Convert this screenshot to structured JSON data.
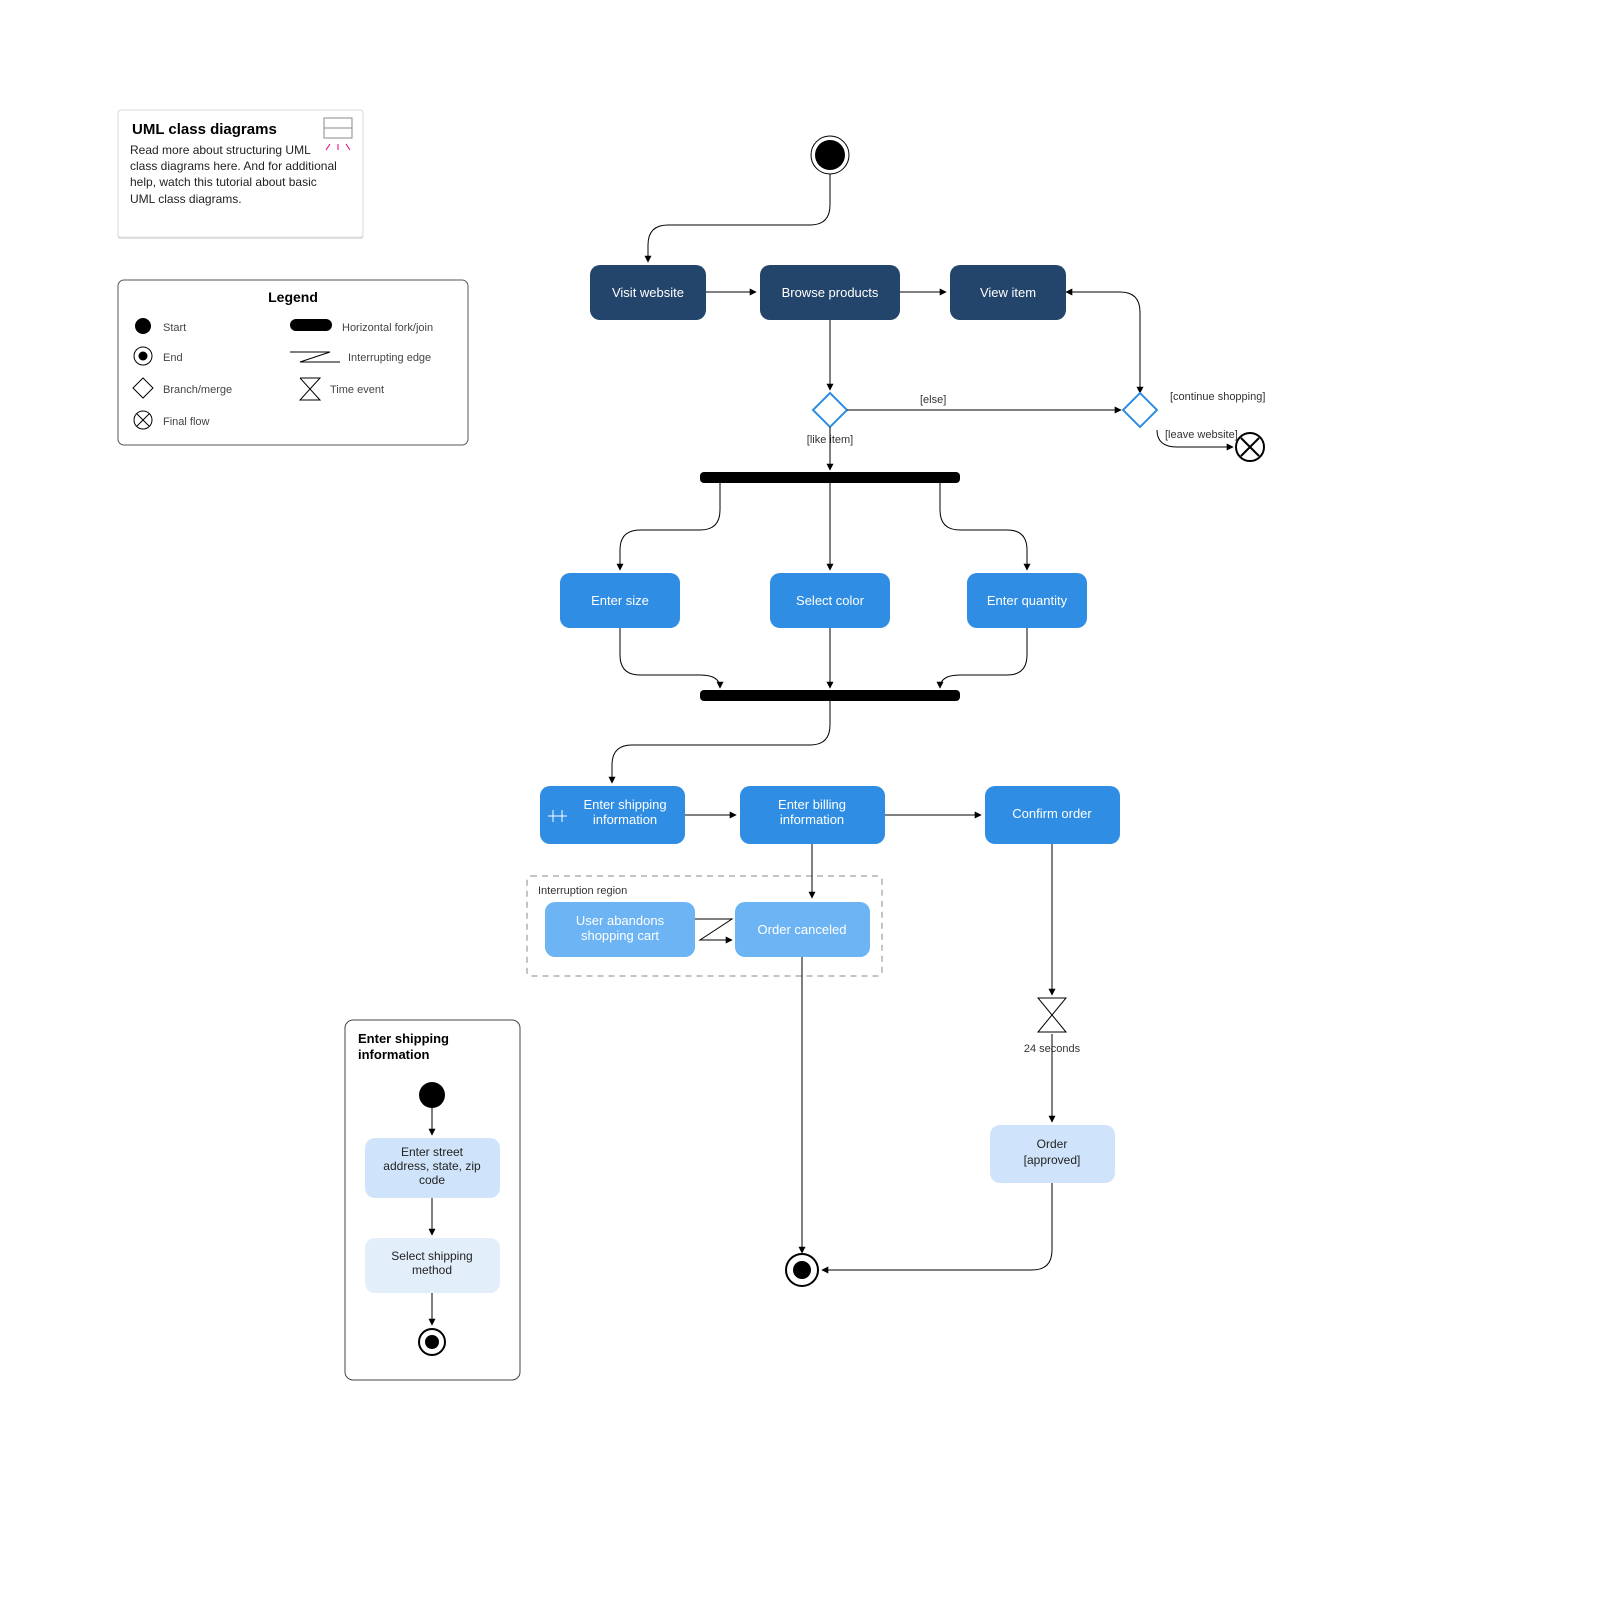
{
  "callout": {
    "title": "UML class diagrams",
    "body": "Read more about structuring UML class diagrams here. And for additional help, watch this tutorial about basic UML class diagrams."
  },
  "legend": {
    "title": "Legend",
    "items": {
      "start": "Start",
      "end": "End",
      "branch": "Branch/merge",
      "final": "Final flow",
      "hfork": "Horizontal fork/join",
      "iedge": "Interrupting edge",
      "timee": "Time event"
    }
  },
  "nodes": {
    "visit": "Visit website",
    "browse": "Browse products",
    "view": "View item",
    "size": "Enter size",
    "color": "Select color",
    "qty": "Enter quantity",
    "ship": "Enter shipping information",
    "bill": "Enter billing information",
    "confirm": "Confirm order",
    "abandon": "User abandons shopping cart",
    "cancel": "Order canceled",
    "approved": "Order\n[approved]"
  },
  "guards": {
    "like": "[like item]",
    "else": "[else]",
    "cont": "[continue shopping]",
    "leave": "[leave website]"
  },
  "region": "Interruption region",
  "timer": "24 seconds",
  "sub": {
    "title": "Enter shipping information",
    "a": "Enter street address, state, zip code",
    "b": "Select shipping method"
  }
}
